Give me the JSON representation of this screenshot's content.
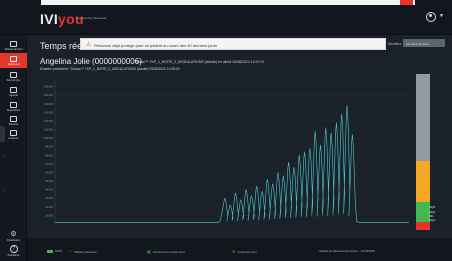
{
  "header": {
    "logo_part1": "IVI",
    "logo_part2": "you",
    "logo_sub": "powered by Neoventa"
  },
  "sidebar": {
    "items": [
      {
        "label": "Tableau de bord",
        "icon": "dashboard-icon"
      },
      {
        "label": "Temps réel",
        "icon": "realtime-icon"
      },
      {
        "label": "Suivi du jour",
        "icon": "today-icon"
      },
      {
        "label": "Agenda",
        "icon": "calendar-icon"
      },
      {
        "label": "Acquisitions",
        "icon": "acquisitions-icon"
      },
      {
        "label": "Sécurité",
        "icon": "security-icon"
      },
      {
        "label": "Analyses",
        "icon": "analyses-icon"
      }
    ],
    "settings_label": "Paramètres",
    "help_label": "Assistance"
  },
  "page": {
    "title": "Temps réel",
    "alert_text": "Personne déjà protégé pour ce patient au cours des 30 derniers jours",
    "monitor_label": "Moniteur",
    "monitor_value": "Moniteur de base"
  },
  "patient": {
    "name": "Angelina Jolie (0000000006)",
    "trace": "Thorax™ TKP_1_BOITE_2_MODULATIONS (Adulte) en direct 25/08/2022 10:47:07",
    "previous": "Examen précédent : Thorax™ TKP_1_BOITE_2_MODULATIONS (Adulte) 25/08/2022 10:38:00"
  },
  "chart_data": {
    "type": "line",
    "ylim": [
      0,
      170000
    ],
    "yticks": [
      10000,
      20000,
      30000,
      40000,
      50000,
      60000,
      70000,
      80000,
      90000,
      100000,
      110000,
      120000,
      130000,
      140000,
      150000,
      160000
    ],
    "ylabel": "",
    "color": "#4ec9d0",
    "baseline_until": 0.46,
    "baseline_value": 1500,
    "end_at": 0.86,
    "peaks": [
      {
        "t": 0.48,
        "v": 30000
      },
      {
        "t": 0.495,
        "v": 22000
      },
      {
        "t": 0.51,
        "v": 36000
      },
      {
        "t": 0.525,
        "v": 28000
      },
      {
        "t": 0.54,
        "v": 40000
      },
      {
        "t": 0.555,
        "v": 33000
      },
      {
        "t": 0.57,
        "v": 44000
      },
      {
        "t": 0.585,
        "v": 38000
      },
      {
        "t": 0.6,
        "v": 52000
      },
      {
        "t": 0.615,
        "v": 47000
      },
      {
        "t": 0.63,
        "v": 60000
      },
      {
        "t": 0.645,
        "v": 56000
      },
      {
        "t": 0.66,
        "v": 72000
      },
      {
        "t": 0.675,
        "v": 66000
      },
      {
        "t": 0.69,
        "v": 80000
      },
      {
        "t": 0.705,
        "v": 84000
      },
      {
        "t": 0.72,
        "v": 88000
      },
      {
        "t": 0.735,
        "v": 108000
      },
      {
        "t": 0.75,
        "v": 92000
      },
      {
        "t": 0.765,
        "v": 112000
      },
      {
        "t": 0.78,
        "v": 106000
      },
      {
        "t": 0.795,
        "v": 118000
      },
      {
        "t": 0.81,
        "v": 128000
      },
      {
        "t": 0.825,
        "v": 138000
      },
      {
        "t": 0.84,
        "v": 104000
      }
    ]
  },
  "gauge": {
    "segments": [
      {
        "color": "#909aa3",
        "from": 0.44,
        "to": 1.0
      },
      {
        "color": "#f5a623",
        "from": 0.18,
        "to": 0.44
      },
      {
        "color": "#3fb950",
        "from": 0.05,
        "to": 0.18
      },
      {
        "color": "#e6352b",
        "from": 0.0,
        "to": 0.05
      }
    ],
    "labels": [
      "NQ3",
      "NQ2",
      "Min",
      "NQ1"
    ]
  },
  "footer": {
    "battery": "100%",
    "tablet": "Tablette présentée",
    "remote": "Connecté au réseau local",
    "network": "Connexion wi-fi",
    "valid": "Validité de l'abonnement IVIyou : 13/10/2028"
  }
}
